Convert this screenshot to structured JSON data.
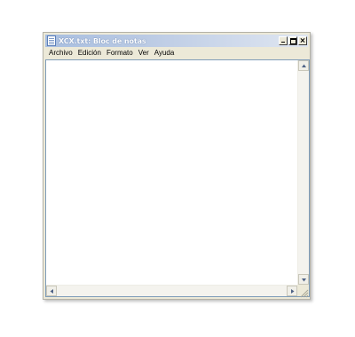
{
  "window": {
    "title": "XCX.txt: Bloc de notas",
    "icon": "notepad-icon",
    "controls": [
      "minimize-icon",
      "maximize-icon",
      "close-icon"
    ]
  },
  "menubar": {
    "items": [
      "Archivo",
      "Edición",
      "Formato",
      "Ver",
      "Ayuda"
    ]
  },
  "editor": {
    "content": ""
  },
  "colors": {
    "titlebar_start": "#a9bfe0",
    "titlebar_end": "#dfe6f1",
    "window_face": "#ece9d8",
    "editor_bg": "#ffffff"
  }
}
